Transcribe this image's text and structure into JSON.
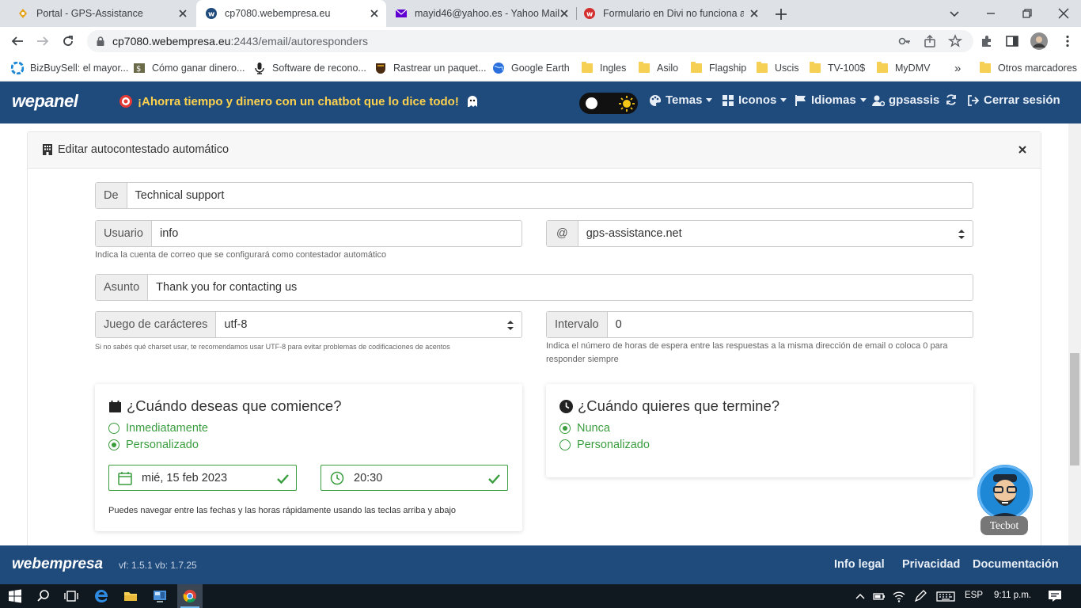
{
  "browser": {
    "tabs": [
      {
        "label": "Portal - GPS-Assistance",
        "icon": "gps-favicon"
      },
      {
        "label": "cp7080.webempresa.eu",
        "icon": "webempresa-favicon"
      },
      {
        "label": "mayid46@yahoo.es - Yahoo Mail",
        "icon": "yahoo-mail-favicon"
      },
      {
        "label": "Formulario en Divi no funciona a",
        "icon": "webempresa-favicon"
      }
    ],
    "url_host": "cp7080.webempresa.eu",
    "url_rest": ":2443/email/autoresponders",
    "bookmarks": [
      {
        "label": "BizBuySell: el mayor...",
        "icon": "bizbuysell-icon"
      },
      {
        "label": "Cómo ganar dinero...",
        "icon": "dollar-icon"
      },
      {
        "label": "Software de recono...",
        "icon": "microphone-icon"
      },
      {
        "label": "Rastrear un paquet...",
        "icon": "ups-icon"
      },
      {
        "label": "Google Earth",
        "icon": "globe-icon"
      },
      {
        "label": "Ingles",
        "icon": "folder-icon"
      },
      {
        "label": "Asilo",
        "icon": "folder-icon"
      },
      {
        "label": "Flagship",
        "icon": "folder-icon"
      },
      {
        "label": "Uscis",
        "icon": "folder-icon"
      },
      {
        "label": "TV-100$",
        "icon": "folder-icon"
      },
      {
        "label": "MyDMV",
        "icon": "folder-icon"
      }
    ],
    "bookmarks_more": "»",
    "other_bookmarks": "Otros marcadores"
  },
  "header": {
    "logo": "wepanel",
    "promo": "¡Ahorra tiempo y dinero con un chatbot que lo dice todo!",
    "menu": {
      "temas": "Temas",
      "iconos": "Iconos",
      "idiomas": "Idiomas",
      "user": "gpsassis",
      "logout": "Cerrar sesión"
    }
  },
  "panel": {
    "title": "Editar autocontestado automático",
    "de_label": "De",
    "de_value": "Technical support",
    "usuario_label": "Usuario",
    "usuario_value": "info",
    "at_label": "@",
    "domain_value": "gps-assistance.net",
    "usuario_help": "Indica la cuenta de correo que se configurará como contestador automático",
    "asunto_label": "Asunto",
    "asunto_value": "Thank you for contacting us",
    "charset_label": "Juego de carácteres",
    "charset_value": "utf-8",
    "charset_help": "Si no sabés qué charset usar, te recomendamos usar UTF-8 para evitar problemas de codificaciones de acentos",
    "intervalo_label": "Intervalo",
    "intervalo_value": "0",
    "intervalo_help": "Indica el número de horas de espera entre las respuestas a la misma dirección de email o coloca 0 para responder siempre",
    "start": {
      "title": "¿Cuándo deseas que comience?",
      "option1": "Inmediatamente",
      "option2": "Personalizado",
      "selected": 2,
      "date": "mié, 15 feb 2023",
      "time": "20:30",
      "help": "Puedes navegar entre las fechas y las horas rápidamente usando las teclas arriba y abajo"
    },
    "end": {
      "title": "¿Cuándo quieres que termine?",
      "option1": "Nunca",
      "option2": "Personalizado",
      "selected": 1
    }
  },
  "chatbot": {
    "name": "Tecbot"
  },
  "footer": {
    "logo": "webempresa",
    "version": "vf: 1.5.1 vb: 1.7.25",
    "links": [
      "Info legal",
      "Privacidad",
      "Documentación"
    ]
  },
  "taskbar": {
    "lang": "ESP",
    "time": "9:11 p.m."
  },
  "colors": {
    "header_bg": "#1f4a7c",
    "accent_green": "#3a9d3e",
    "promo_yellow": "#ffd24d"
  }
}
